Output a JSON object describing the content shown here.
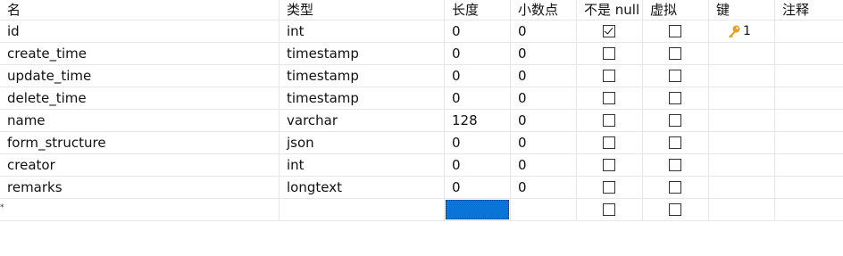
{
  "columns": {
    "name": "名",
    "type": "类型",
    "length": "长度",
    "decimals": "小数点",
    "not_null": "不是 null",
    "virtual": "虚拟",
    "key": "键",
    "comment": "注释"
  },
  "rows": [
    {
      "name": "id",
      "type": "int",
      "length": "0",
      "decimals": "0",
      "not_null": true,
      "virtual": false,
      "key": "1",
      "comment": ""
    },
    {
      "name": "create_time",
      "type": "timestamp",
      "length": "0",
      "decimals": "0",
      "not_null": false,
      "virtual": false,
      "key": "",
      "comment": ""
    },
    {
      "name": "update_time",
      "type": "timestamp",
      "length": "0",
      "decimals": "0",
      "not_null": false,
      "virtual": false,
      "key": "",
      "comment": ""
    },
    {
      "name": "delete_time",
      "type": "timestamp",
      "length": "0",
      "decimals": "0",
      "not_null": false,
      "virtual": false,
      "key": "",
      "comment": ""
    },
    {
      "name": "name",
      "type": "varchar",
      "length": "128",
      "decimals": "0",
      "not_null": false,
      "virtual": false,
      "key": "",
      "comment": ""
    },
    {
      "name": "form_structure",
      "type": "json",
      "length": "0",
      "decimals": "0",
      "not_null": false,
      "virtual": false,
      "key": "",
      "comment": ""
    },
    {
      "name": "creator",
      "type": "int",
      "length": "0",
      "decimals": "0",
      "not_null": false,
      "virtual": false,
      "key": "",
      "comment": ""
    },
    {
      "name": "remarks",
      "type": "longtext",
      "length": "0",
      "decimals": "0",
      "not_null": false,
      "virtual": false,
      "key": "",
      "comment": ""
    }
  ],
  "new_row": {
    "indicator": "*",
    "not_null": false,
    "virtual": false
  },
  "colors": {
    "selection": "#0a74d8",
    "key_icon": "#e0a21b",
    "grid_line": "#e6e6e6"
  },
  "icons": {
    "primary_key": "key-icon"
  }
}
